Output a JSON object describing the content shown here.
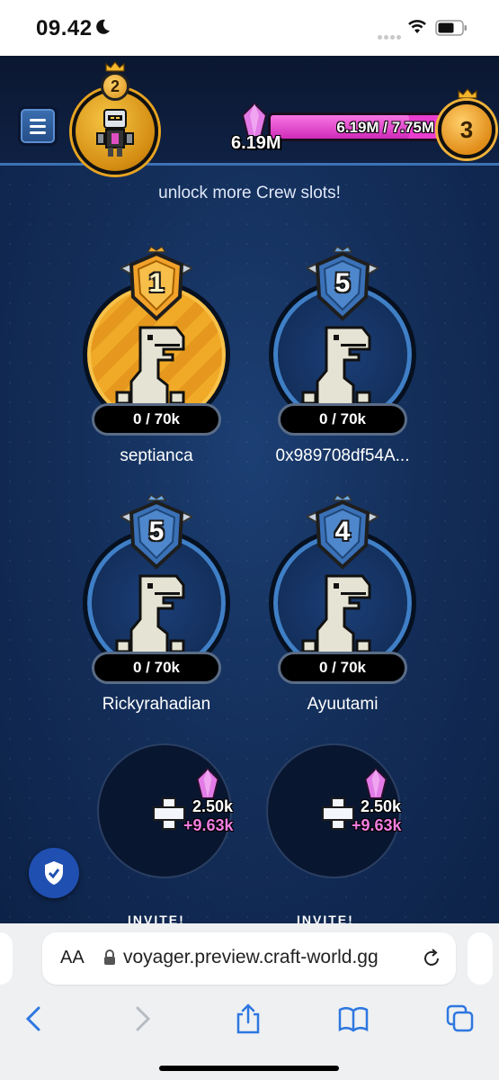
{
  "status_bar": {
    "time": "09.42"
  },
  "header": {
    "player_level": "2",
    "gem_amount": "6.19M",
    "xp_text": "6.19M / 7.75M",
    "xp_progress": 0.8,
    "next_level": "3"
  },
  "crew": {
    "unlock_text": "unlock more Crew slots!",
    "members": [
      {
        "rank": "1",
        "progress": "0 / 70k",
        "name": "septianca"
      },
      {
        "rank": "5",
        "progress": "0 / 70k",
        "name": "0x989708df54A..."
      },
      {
        "rank": "5",
        "progress": "0 / 70k",
        "name": "Rickyrahadian"
      },
      {
        "rank": "4",
        "progress": "0 / 70k",
        "name": "Ayuutami"
      }
    ],
    "slots": [
      {
        "cost": "2.50k",
        "bonus": "+9.63k",
        "label": "INVITE!"
      },
      {
        "cost": "2.50k",
        "bonus": "+9.63k",
        "label": "INVITE!"
      }
    ]
  },
  "browser": {
    "aa_label": "AA",
    "url": "voyager.preview.craft-world.gg"
  }
}
